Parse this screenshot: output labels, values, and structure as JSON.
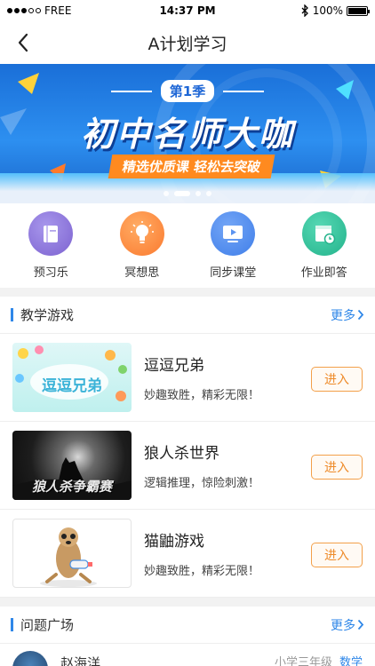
{
  "status_bar": {
    "carrier": "FREE",
    "time": "14:37 PM",
    "battery": "100%",
    "battery_level": 1.0
  },
  "nav": {
    "title": "A计划学习"
  },
  "banner": {
    "season": "第1季",
    "title": "初中名师大咖",
    "subtitle": "精选优质课  轻松去突破",
    "pages": 4,
    "active_page": 1
  },
  "quick_nav": [
    {
      "label": "预习乐",
      "icon": "book-icon",
      "color": "#8b74d8"
    },
    {
      "label": "冥想思",
      "icon": "lightbulb-icon",
      "color": "#ff8a3c"
    },
    {
      "label": "同步课堂",
      "icon": "video-player-icon",
      "color": "#4a86ee"
    },
    {
      "label": "作业即答",
      "icon": "calendar-clock-icon",
      "color": "#2fbf9a"
    }
  ],
  "games_section": {
    "title": "教学游戏",
    "more": "更多"
  },
  "games": [
    {
      "name": "逗逗兄弟",
      "desc": "妙趣致胜，精彩无限！",
      "button": "进入",
      "thumb_text": "逗逗兄弟"
    },
    {
      "name": "狼人杀世界",
      "desc": "逻辑推理，惊险刺激！",
      "button": "进入",
      "thumb_text": "狼人杀争霸赛"
    },
    {
      "name": "猫鼬游戏",
      "desc": "妙趣致胜，精彩无限！",
      "button": "进入",
      "thumb_text": ""
    }
  ],
  "questions_section": {
    "title": "问题广场",
    "more": "更多"
  },
  "question": {
    "name": "赵海洋",
    "grade": "小学三年级",
    "subject": "数学"
  }
}
